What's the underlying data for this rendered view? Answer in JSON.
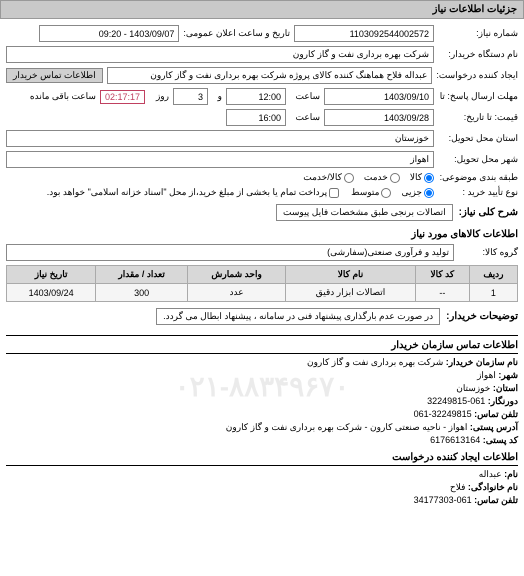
{
  "watermark": "۰۲۱-۸۸۳۴۹۶۷۰",
  "header": {
    "title": "جزئیات اطلاعات نیاز"
  },
  "form": {
    "need_number_label": "شماره نیاز:",
    "need_number": "1103092544002572",
    "announce_label": "تاریخ و ساعت اعلان عمومی:",
    "announce_value": "1403/09/07 - 09:20",
    "buyer_org_label": "نام دستگاه خریدار:",
    "buyer_org": "شرکت بهره برداری نفت و گاز کارون",
    "requester_label": "ایجاد کننده درخواست:",
    "requester": "عبداله فلاح هماهنگ کننده کالای پروژه شرکت بهره برداری نفت و گاز کارون",
    "buyer_contact_btn": "اطلاعات تماس خریدار",
    "deadline_until_label": "مهلت ارسال پاسخ: تا",
    "deadline_date": "1403/09/10",
    "time_label": "ساعت",
    "deadline_time": "12:00",
    "and_label": "و",
    "days_left": "3",
    "day_label": "روز",
    "time_remaining": "02:17:17",
    "time_remaining_label": "ساعت باقی مانده",
    "validity_until_label": "قیمت: تا تاریخ:",
    "validity_date": "1403/09/28",
    "validity_time": "16:00",
    "delivery_state_label": "استان محل تحویل:",
    "delivery_state": "خوزستان",
    "delivery_city_label": "شهر محل تحویل:",
    "delivery_city": "اهواز",
    "subject_class_label": "طبقه بندی موضوعی:",
    "purchase_type_label": "نوع تأیید خرید :",
    "radio_goods": "کالا",
    "radio_service": "خدمت",
    "radio_both": "کالا/خدمت",
    "radio_small": "جزیی",
    "radio_medium": "متوسط",
    "payment_note": "پرداخت تمام یا بخشی از مبلغ خرید،از محل \"اسناد خزانه اسلامی\" خواهد بود.",
    "main_desc_label": "شرح کلی نیاز:",
    "main_desc": "اتصالات برنجی طبق مشخصات فایل پیوست",
    "items_heading": "اطلاعات کالاهای مورد نیاز",
    "group_label": "گروه کالا:",
    "group_value": "تولید و فرآوری صنعتی(سفارشی)"
  },
  "table": {
    "headers": [
      "ردیف",
      "کد کالا",
      "نام کالا",
      "واحد شمارش",
      "تعداد / مقدار",
      "تاریخ نیاز"
    ],
    "rows": [
      {
        "idx": "1",
        "code": "--",
        "name": "اتصالات ابزار دقیق",
        "unit": "عدد",
        "qty": "300",
        "date": "1403/09/24"
      }
    ]
  },
  "buyer_note_label": "توضیحات خریدار:",
  "buyer_note": "در صورت عدم بارگذاری پیشنهاد فنی در سامانه ، پیشنهاد ابطال می گردد.",
  "contact": {
    "section1_title": "اطلاعات تماس سازمان خریدار",
    "org_name_label": "نام سازمان خریدار:",
    "org_name": "شرکت بهره برداری نفت و گاز کارون",
    "city_label": "شهر:",
    "city": "اهواز",
    "state_label": "استان:",
    "state": "خوزستان",
    "switch_label": "دورنگار:",
    "switch": "061-32249815",
    "fax_label": "تلفن تماس:",
    "fax": "32249815-061",
    "addr_label": "آدرس پستی:",
    "addr": "اهواز - ناحیه صنعتی کارون - شرکت بهره برداری نفت و گاز کارون",
    "postal_label": "کد پستی:",
    "postal": "6176613164",
    "section2_title": "اطلاعات ایجاد کننده درخواست",
    "name_label": "نام:",
    "name": "عبداله",
    "family_label": "نام خانوادگی:",
    "family": "فلاح",
    "phone_label": "تلفن تماس:",
    "phone": "061-34177303"
  }
}
